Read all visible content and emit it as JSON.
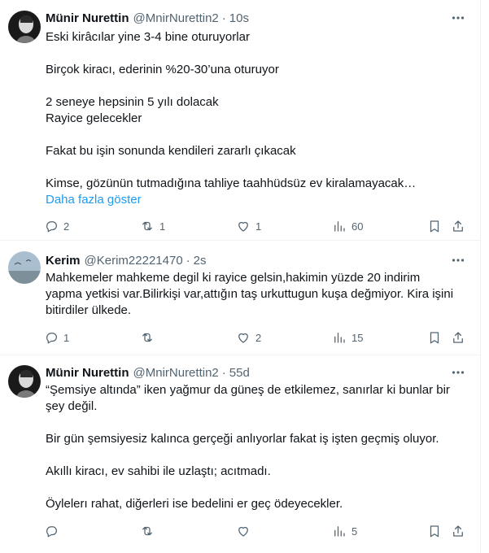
{
  "tweets": [
    {
      "name": "Münir Nurettin",
      "handle": "@MnirNurettin2",
      "time": "10s",
      "lines": [
        "Eski kirâcılar yine 3-4 bine oturuyorlar",
        "",
        "Birçok kiracı, ederinin %20-30’una oturuyor",
        "",
        "2 seneye hepsinin 5 yılı dolacak",
        "Rayice gelecekler",
        "",
        "Fakat bu işin sonunda kendileri zararlı çıkacak",
        "",
        "Kimse, gözünün tutmadığına tahliye taahhüdsüz ev kiralamayacak…"
      ],
      "show_more": "Daha fazla göster",
      "replies": "2",
      "reposts": "1",
      "likes": "1",
      "views": "60"
    },
    {
      "name": "Kerim",
      "handle": "@Kerim22221470",
      "time": "2s",
      "lines": [
        "Mahkemeler mahkeme degil ki rayice gelsin,hakimin yüzde 20 indirim",
        "yapma yetkisi var.Bilirkişi var,attığın taş urkuttugun kuşa değmiyor. Kira işini",
        "bitirdiler ülkede."
      ],
      "replies": "1",
      "reposts": "",
      "likes": "2",
      "views": "15"
    },
    {
      "name": "Münir Nurettin",
      "handle": "@MnirNurettin2",
      "time": "55d",
      "lines": [
        "“Şemsiye altında” iken yağmur da güneş de etkilemez, sanırlar ki bunlar bir",
        "şey değil.",
        "",
        "Bir gün şemsiyesiz kalınca gerçeği anlıyorlar fakat iş işten geçmiş oluyor.",
        "",
        "Akıllı kiracı, ev sahibi ile uzlaştı; acıtmadı.",
        "",
        "Öylelerı rahat, diğerleri ise bedelini er geç ödeyecekler."
      ],
      "replies": "",
      "reposts": "",
      "likes": "",
      "views": "5"
    }
  ],
  "icons": {
    "reply": "reply-icon",
    "repost": "repost-icon",
    "like": "heart-icon",
    "views": "views-chart-icon",
    "bookmark": "bookmark-icon",
    "share": "share-icon",
    "more": "more-dots-icon"
  },
  "colors": {
    "link": "#1d9bf0",
    "secondary_text": "#536471",
    "divider": "#eff3f4"
  }
}
